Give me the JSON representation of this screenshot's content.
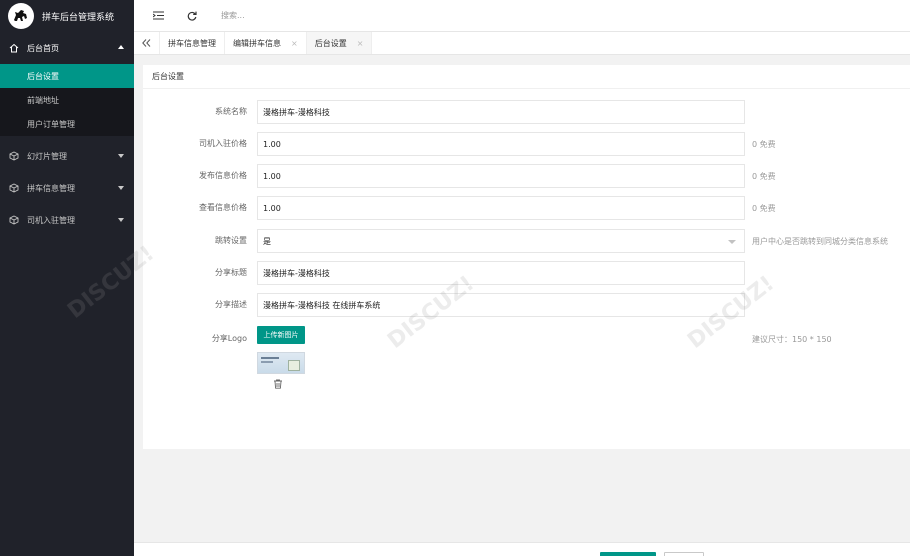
{
  "app": {
    "title": "拼车后台管理系统",
    "logo_icon": "horse-logo-icon"
  },
  "sidebar": {
    "groups": [
      {
        "label": "后台首页",
        "icon": "home-icon",
        "expanded": true,
        "items": [
          {
            "label": "后台设置",
            "active": true
          },
          {
            "label": "前端地址",
            "active": false
          },
          {
            "label": "用户订单管理",
            "active": false
          }
        ]
      },
      {
        "label": "幻灯片管理",
        "icon": "cube-icon",
        "expanded": false
      },
      {
        "label": "拼车信息管理",
        "icon": "cube-icon",
        "expanded": false
      },
      {
        "label": "司机入驻管理",
        "icon": "cube-icon",
        "expanded": false
      }
    ]
  },
  "header": {
    "menu_icon": "menu-fold-icon",
    "refresh_icon": "refresh-icon",
    "search_placeholder": "搜索..."
  },
  "tabs": {
    "back_icon": "double-chevron-left-icon",
    "items": [
      {
        "label": "拼车信息管理",
        "closable": false,
        "active": false
      },
      {
        "label": "编辑拼车信息",
        "closable": true,
        "active": false
      },
      {
        "label": "后台设置",
        "closable": true,
        "active": true
      }
    ],
    "close_glyph": "×"
  },
  "form": {
    "title": "后台设置",
    "fields": [
      {
        "label": "系统名称",
        "value": "漫格拼车-漫格科技",
        "aux": ""
      },
      {
        "label": "司机入驻价格",
        "value": "1.00",
        "aux": "0 免费"
      },
      {
        "label": "发布信息价格",
        "value": "1.00",
        "aux": "0 免费"
      },
      {
        "label": "查看信息价格",
        "value": "1.00",
        "aux": "0 免费"
      },
      {
        "label": "跳转设置",
        "value": "是",
        "aux": "用户中心是否跳转到同城分类信息系统",
        "type": "select"
      },
      {
        "label": "分享标题",
        "value": "漫格拼车-漫格科技",
        "aux": ""
      },
      {
        "label": "分享描述",
        "value": "漫格拼车-漫格科技  在线拼车系统",
        "aux": ""
      }
    ],
    "logo": {
      "label": "分享Logo",
      "upload_label": "上传新图片",
      "size_hint": "建议尺寸：150 * 150",
      "delete_icon": "trash-icon"
    }
  },
  "theme": {
    "accent": "#009688",
    "sidebar_bg": "#20222a",
    "submenu_bg": "#16171c"
  }
}
